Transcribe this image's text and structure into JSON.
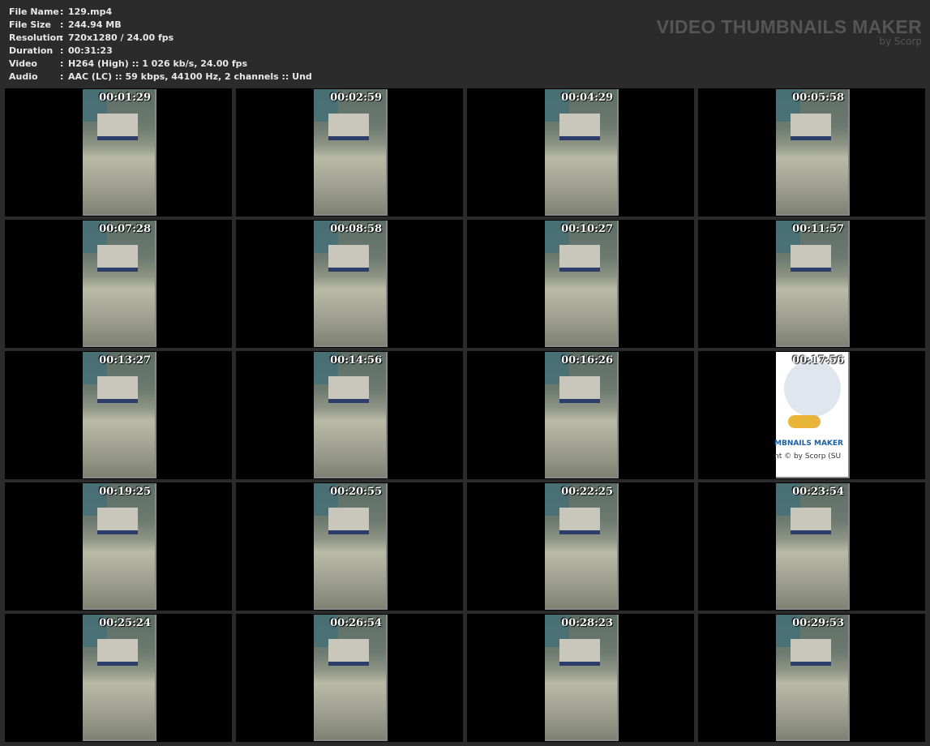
{
  "info": [
    {
      "label": "File Name",
      "value": "129.mp4"
    },
    {
      "label": "File Size",
      "value": "244.94 MB"
    },
    {
      "label": "Resolution",
      "value": "720x1280 / 24.00 fps"
    },
    {
      "label": "Duration",
      "value": "00:31:23"
    },
    {
      "label": "Video",
      "value": "H264 (High) :: 1 026 kb/s, 24.00 fps"
    },
    {
      "label": "Audio",
      "value": "AAC (LC) :: 59 kbps, 44100 Hz, 2 channels :: Und"
    }
  ],
  "separator": ":",
  "brand": {
    "title": "VIDEO THUMBNAILS MAKER",
    "subtitle": "by Scorp"
  },
  "owl_frame": {
    "line1": "MBNAILS MAKER",
    "line2": "nt © by Scorp (SU"
  },
  "thumbnails": [
    "00:01:29",
    "00:02:59",
    "00:04:29",
    "00:05:58",
    "00:07:28",
    "00:08:58",
    "00:10:27",
    "00:11:57",
    "00:13:27",
    "00:14:56",
    "00:16:26",
    "00:17:56",
    "00:19:25",
    "00:20:55",
    "00:22:25",
    "00:23:54",
    "00:25:24",
    "00:26:54",
    "00:28:23",
    "00:29:53"
  ]
}
